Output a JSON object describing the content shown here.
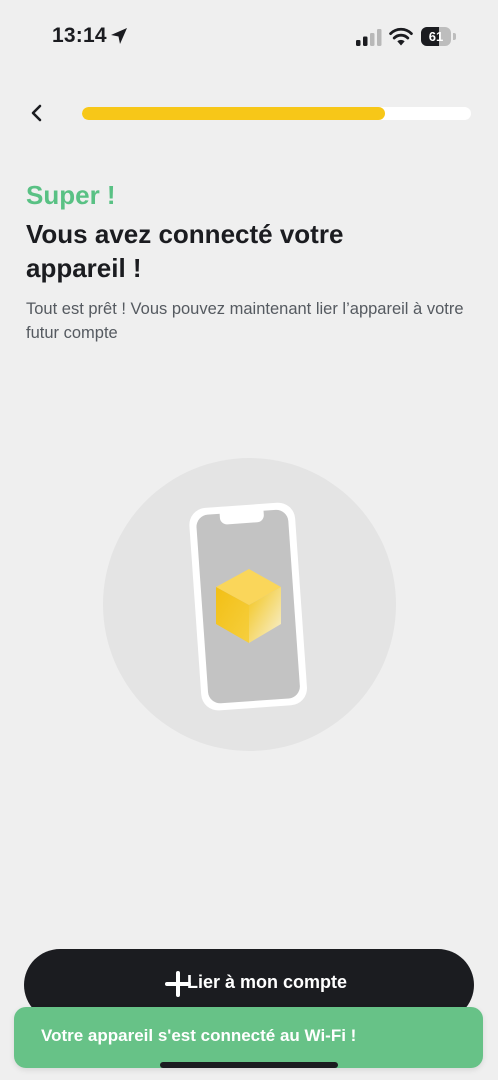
{
  "status_bar": {
    "time": "13:14",
    "battery_level": "61",
    "battery_fraction": 0.61
  },
  "header": {
    "progress_fraction": 0.78
  },
  "content": {
    "eyebrow": "Super !",
    "title": "Vous avez connecté votre appareil !",
    "subtitle": "Tout est prêt ! Vous pouvez maintenant lier l’appareil à votre futur compte"
  },
  "actions": {
    "link_account_label": "Lier à mon compte"
  },
  "toast": {
    "message": "Votre appareil s'est connecté au Wi-Fi !"
  },
  "colors": {
    "accent_green": "#59c184",
    "progress_yellow": "#f7c718",
    "button_dark": "#1b1c20",
    "toast_green": "#67c287"
  },
  "icons": {
    "back": "chevron-left-icon",
    "add": "plus-icon",
    "device": "phone-with-cube-illustration"
  }
}
